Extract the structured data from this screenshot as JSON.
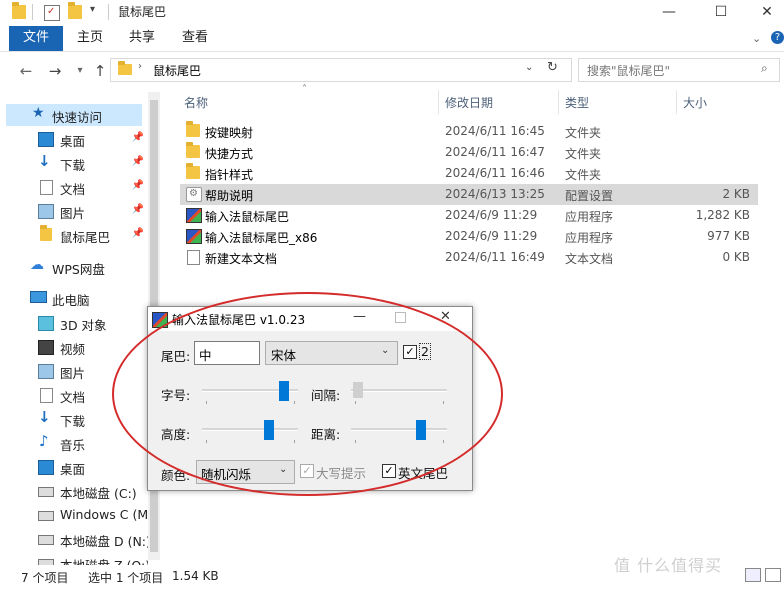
{
  "window": {
    "title": "鼠标尾巴",
    "controls": {
      "minimize": "—",
      "maximize": "☐",
      "close": "✕"
    }
  },
  "ribbon": {
    "file": "文件",
    "tabs": [
      "主页",
      "共享",
      "查看"
    ],
    "help": "?"
  },
  "address": {
    "path": "鼠标尾巴"
  },
  "search": {
    "placeholder": "搜索\"鼠标尾巴\""
  },
  "sidebar": {
    "items": [
      {
        "label": "快速访问",
        "icon": "star-icon",
        "pinned": false
      },
      {
        "label": "桌面",
        "icon": "desktop-icon",
        "pinned": true
      },
      {
        "label": "下载",
        "icon": "download-arrow-icon",
        "pinned": true
      },
      {
        "label": "文档",
        "icon": "document-icon",
        "pinned": true
      },
      {
        "label": "图片",
        "icon": "picture-icon",
        "pinned": true
      },
      {
        "label": "鼠标尾巴",
        "icon": "folder-icon",
        "pinned": true
      },
      {
        "label": "WPS网盘",
        "icon": "cloud-icon",
        "pinned": false
      },
      {
        "label": "此电脑",
        "icon": "computer-icon",
        "pinned": false
      },
      {
        "label": "3D 对象",
        "icon": "cube-icon",
        "pinned": false
      },
      {
        "label": "视频",
        "icon": "film-icon",
        "pinned": false
      },
      {
        "label": "图片",
        "icon": "picture-icon",
        "pinned": false
      },
      {
        "label": "文档",
        "icon": "document-icon",
        "pinned": false
      },
      {
        "label": "下载",
        "icon": "download-arrow-icon",
        "pinned": false
      },
      {
        "label": "音乐",
        "icon": "music-note-icon",
        "pinned": false
      },
      {
        "label": "桌面",
        "icon": "desktop-icon",
        "pinned": false
      },
      {
        "label": "本地磁盘 (C:)",
        "icon": "drive-icon",
        "pinned": false
      },
      {
        "label": "Windows C (M",
        "icon": "drive-icon",
        "pinned": false
      },
      {
        "label": "本地磁盘 D (N:)",
        "icon": "drive-icon",
        "pinned": false
      },
      {
        "label": "本地磁盘 Z (O:)",
        "icon": "drive-icon",
        "pinned": false
      }
    ]
  },
  "file_list": {
    "columns": [
      "名称",
      "修改日期",
      "类型",
      "大小"
    ],
    "rows": [
      {
        "name": "按键映射",
        "date": "2024/6/11 16:45",
        "type": "文件夹",
        "size": "",
        "icon": "folder-icon",
        "selected": false
      },
      {
        "name": "快捷方式",
        "date": "2024/6/11 16:47",
        "type": "文件夹",
        "size": "",
        "icon": "folder-icon",
        "selected": false
      },
      {
        "name": "指针样式",
        "date": "2024/6/11 16:46",
        "type": "文件夹",
        "size": "",
        "icon": "folder-icon",
        "selected": false
      },
      {
        "name": "帮助说明",
        "date": "2024/6/13 13:25",
        "type": "配置设置",
        "size": "2 KB",
        "icon": "settings-file-icon",
        "selected": true
      },
      {
        "name": "输入法鼠标尾巴",
        "date": "2024/6/9 11:29",
        "type": "应用程序",
        "size": "1,282 KB",
        "icon": "app-icon",
        "selected": false
      },
      {
        "name": "输入法鼠标尾巴_x86",
        "date": "2024/6/9 11:29",
        "type": "应用程序",
        "size": "977 KB",
        "icon": "app-icon",
        "selected": false
      },
      {
        "name": "新建文本文档",
        "date": "2024/6/11 16:49",
        "type": "文本文档",
        "size": "0 KB",
        "icon": "text-file-icon",
        "selected": false
      }
    ]
  },
  "status": {
    "item_count": "7 个项目",
    "selection": "选中 1 个项目",
    "size": "1.54 KB"
  },
  "dialog": {
    "title": "输入法鼠标尾巴 v1.0.23",
    "tail_label": "尾巴:",
    "tail_value": "中",
    "font_value": "宋体",
    "checkbox_value": "2",
    "font_size_label": "字号:",
    "spacing_label": "间隔:",
    "height_label": "高度:",
    "distance_label": "距离:",
    "color_label": "颜色:",
    "color_value": "随机闪烁",
    "caps_label": "大写提示",
    "english_label": "英文尾巴",
    "sliders": {
      "font_size": 0.9,
      "spacing": 0.02,
      "height": 0.72,
      "distance": 0.75
    },
    "checks": {
      "option2": true,
      "caps": true,
      "english": true
    }
  },
  "watermark": "值 什么值得买",
  "colors": {
    "accent": "#1a64b4",
    "selection": "#d9d9d9",
    "annotation": "#d42b2b",
    "slider": "#0078d7"
  }
}
